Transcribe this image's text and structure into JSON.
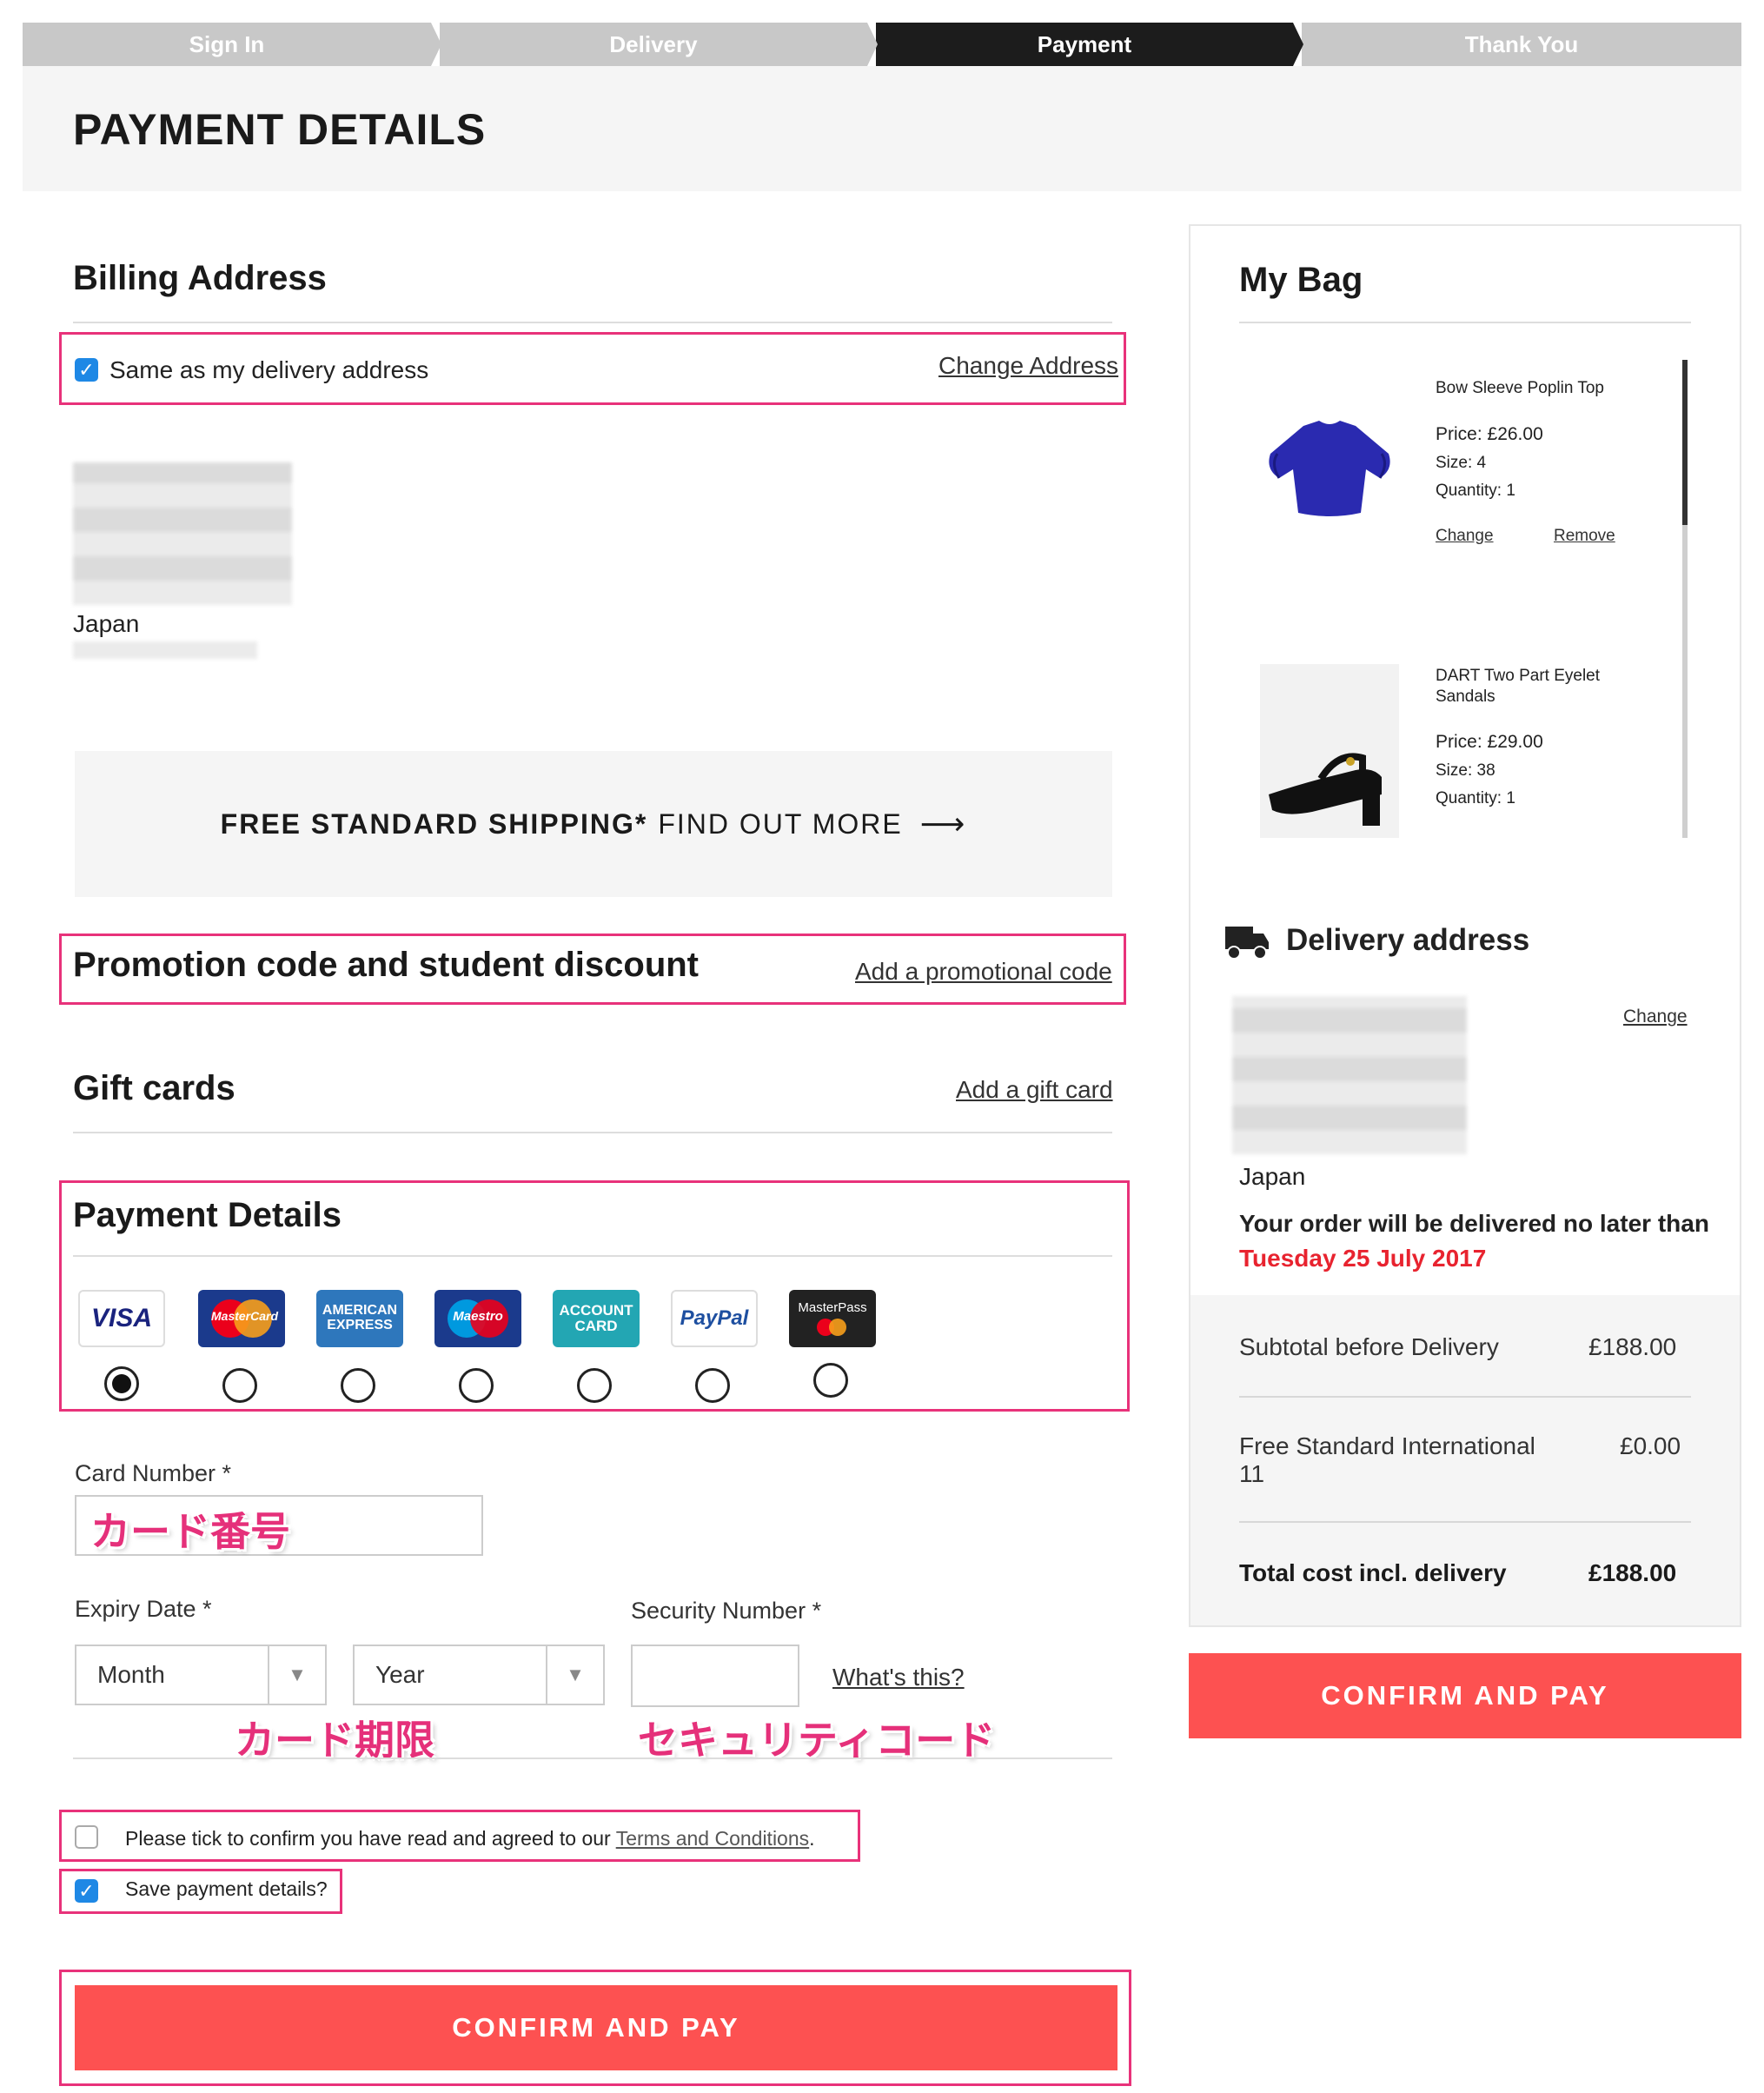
{
  "steps": [
    "Sign In",
    "Delivery",
    "Payment",
    "Thank You"
  ],
  "page_title": "PAYMENT DETAILS",
  "billing": {
    "heading": "Billing Address",
    "same_as_delivery_label": "Same as my delivery address",
    "same_as_delivery_checked": true,
    "change_address": "Change Address",
    "country": "Japan"
  },
  "shipping_banner": {
    "bold": "FREE STANDARD SHIPPING*",
    "rest": "FIND OUT MORE",
    "arrow": "⟶"
  },
  "promotion": {
    "heading": "Promotion code and student discount",
    "link": "Add a promotional code"
  },
  "gift_cards": {
    "heading": "Gift cards",
    "link": "Add a gift card"
  },
  "payment": {
    "heading": "Payment Details",
    "methods": [
      "VISA",
      "MasterCard",
      "AMERICAN EXPRESS",
      "Maestro",
      "ACCOUNT CARD",
      "PayPal",
      "MasterPass"
    ],
    "selected_index": 0,
    "card_number_label": "Card Number *",
    "card_number_annotation": "カード番号",
    "expiry_label": "Expiry Date *",
    "month_placeholder": "Month",
    "year_placeholder": "Year",
    "expiry_annotation": "カード期限",
    "security_label": "Security Number *",
    "whats_this": "What's this?",
    "security_annotation": "セキュリティコード",
    "terms_text": "Please tick to confirm you have read and agreed to our ",
    "terms_link": "Terms and Conditions",
    "terms_end": ".",
    "terms_checked": false,
    "save_label": "Save payment details?",
    "save_checked": true,
    "confirm_button": "CONFIRM AND PAY"
  },
  "bag": {
    "heading": "My Bag",
    "items": [
      {
        "name": "Bow Sleeve Poplin Top",
        "price": "Price: £26.00",
        "size": "Size: 4",
        "quantity": "Quantity: 1",
        "change": "Change",
        "remove": "Remove"
      },
      {
        "name": "DART Two Part Eyelet Sandals",
        "price": "Price: £29.00",
        "size": "Size: 38",
        "quantity": "Quantity: 1"
      }
    ]
  },
  "delivery": {
    "heading": "Delivery address",
    "change": "Change",
    "country": "Japan",
    "message": "Your order will be delivered no later than",
    "date": "Tuesday 25 July 2017"
  },
  "summary": {
    "subtotal_label": "Subtotal before Delivery",
    "subtotal_value": "£188.00",
    "shipping_label_line1": "Free Standard International",
    "shipping_label_line2": "11",
    "shipping_value": "£0.00",
    "total_label": "Total cost incl. delivery",
    "total_value": "£188.00"
  },
  "confirm_button_right": "CONFIRM AND PAY",
  "colors": {
    "accent": "#fd5151",
    "annotation": "#e5307a",
    "date": "#e8232f"
  }
}
